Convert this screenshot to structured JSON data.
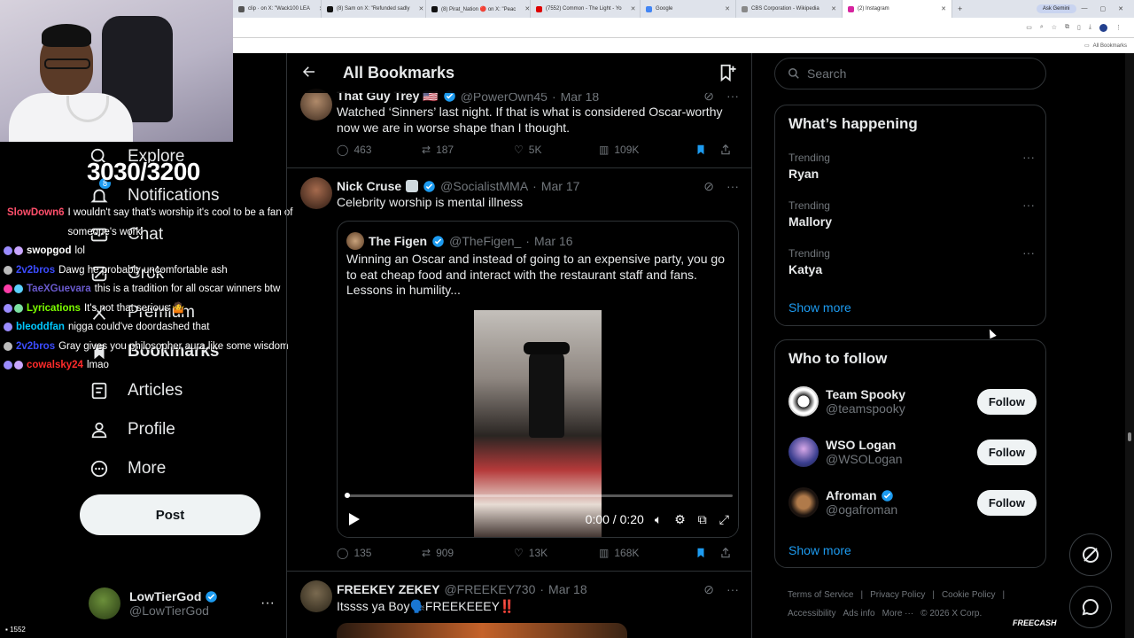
{
  "browser": {
    "tabs": [
      {
        "label": "clip · on X: \"Wack100 LEA",
        "color": "#777"
      },
      {
        "label": "(8) Sam on X: \"Refunded sadly",
        "color": "#111"
      },
      {
        "label": "(8) Pirat_Nation 🔴 on X: \"Peac",
        "color": "#111"
      },
      {
        "label": "(7552) Common - The Light - Yo",
        "color": "#d00"
      },
      {
        "label": "Google",
        "color": "#4285f4"
      },
      {
        "label": "CBS Corporation - Wikipedia",
        "color": "#888"
      },
      {
        "label": "(2) Instagram",
        "color": "#d6249f"
      }
    ],
    "gemini": "Ask Gemini",
    "bookmarks_folder": "All Bookmarks"
  },
  "overlay": {
    "score": "3030/3200",
    "viewers": "1552",
    "chat": [
      {
        "user": "SlowDown6",
        "color": "#ff4f6b",
        "msg": "I wouldn't say that's worship it's cool to be a fan of someone's work",
        "badges": []
      },
      {
        "user": "swopgod",
        "color": "#ffffff",
        "msg": "lol",
        "badges": [
          "#9b8cff",
          "#c9a6ff"
        ]
      },
      {
        "user": "2v2bros",
        "color": "#3c4cff",
        "msg": "Dawg he probably uncomfortable ash",
        "badges": [
          "#bbbbbb"
        ]
      },
      {
        "user": "TaeXGuevara",
        "color": "#6a5acd",
        "msg": "this is a tradition for all oscar winners btw",
        "badges": [
          "#ff3da8",
          "#5bd1ff"
        ]
      },
      {
        "user": "Lyrications",
        "color": "#7cfc00",
        "msg": "It's not that serious 🤷",
        "badges": [
          "#9b8cff",
          "#7ce1a2"
        ]
      },
      {
        "user": "bleoddfan",
        "color": "#00c8ff",
        "msg": "nigga could've doordashed that",
        "badges": [
          "#9b8cff"
        ]
      },
      {
        "user": "2v2bros",
        "color": "#3c4cff",
        "msg": "Gray gives you philosopher aura like some wisdom",
        "badges": [
          "#bbbbbb"
        ]
      },
      {
        "user": "cowalsky24",
        "color": "#ff2b2b",
        "msg": "lmao",
        "badges": [
          "#9b8cff",
          "#c9a6ff"
        ]
      }
    ]
  },
  "nav": {
    "items": [
      {
        "label": "Explore",
        "icon": "search-icon"
      },
      {
        "label": "Notifications",
        "icon": "bell-icon",
        "badge": "8"
      },
      {
        "label": "Chat",
        "icon": "mail-icon"
      },
      {
        "label": "Grok",
        "icon": "grok-icon"
      },
      {
        "label": "Premium",
        "icon": "x-logo-icon"
      },
      {
        "label": "Bookmarks",
        "icon": "bookmark-icon"
      },
      {
        "label": "Articles",
        "icon": "article-icon"
      },
      {
        "label": "Profile",
        "icon": "person-icon"
      },
      {
        "label": "More",
        "icon": "more-circle-icon"
      }
    ],
    "post": "Post",
    "account": {
      "name": "LowTierGod",
      "handle": "@LowTierGod"
    }
  },
  "main": {
    "title": "All Bookmarks",
    "tweets": [
      {
        "name": "That Guy Trey 🇺🇸",
        "handle": "@PowerOwn45",
        "date": "Mar 18",
        "text": "Watched ‘Sinners’ last night. If that is what is considered Oscar-worthy now we are in worse shape than I thought.",
        "replies": "463",
        "reposts": "187",
        "likes": "5K",
        "views": "109K"
      },
      {
        "name": "Nick Cruse",
        "handle": "@SocialistMMA",
        "date": "Mar 17",
        "text": "Celebrity worship is mental illness",
        "quote": {
          "name": "The Figen",
          "handle": "@TheFigen_",
          "date": "Mar 16",
          "text": "Winning an Oscar and instead of going to an expensive party, you go to eat cheap food and interact with the restaurant staff and fans. Lessons in humility...",
          "video_time": "0:00 / 0:20",
          "progress": 0
        },
        "replies": "135",
        "reposts": "909",
        "likes": "13K",
        "views": "168K"
      },
      {
        "name": "FREEKEY ZEKEY",
        "handle": "@FREEKEY730",
        "date": "Mar 18",
        "text": "Itssss ya Boy🗣️FREEKEEEY‼️"
      }
    ]
  },
  "right": {
    "search_placeholder": "Search",
    "happening_title": "What’s happening",
    "trends": [
      {
        "label": "Trending",
        "value": "Ryan"
      },
      {
        "label": "Trending",
        "value": "Mallory"
      },
      {
        "label": "Trending",
        "value": "Katya"
      }
    ],
    "show_more": "Show more",
    "follow_title": "Who to follow",
    "follow": [
      {
        "name": "Team Spooky",
        "handle": "@teamspooky",
        "button": "Follow",
        "verified": false
      },
      {
        "name": "WSO Logan",
        "handle": "@WSOLogan",
        "button": "Follow",
        "verified": false
      },
      {
        "name": "Afroman",
        "handle": "@ogafroman",
        "button": "Follow",
        "verified": true
      }
    ],
    "footer": [
      "Terms of Service",
      "|",
      "Privacy Policy",
      "|",
      "Cookie Policy",
      "|",
      "Accessibility",
      "Ads info",
      "More ···",
      "© 2026 X Corp."
    ],
    "freecash": "FREECASH"
  },
  "colors": {
    "accent": "#1d9bf0",
    "background": "#000000",
    "border": "#2f3336",
    "muted": "#71767b"
  }
}
